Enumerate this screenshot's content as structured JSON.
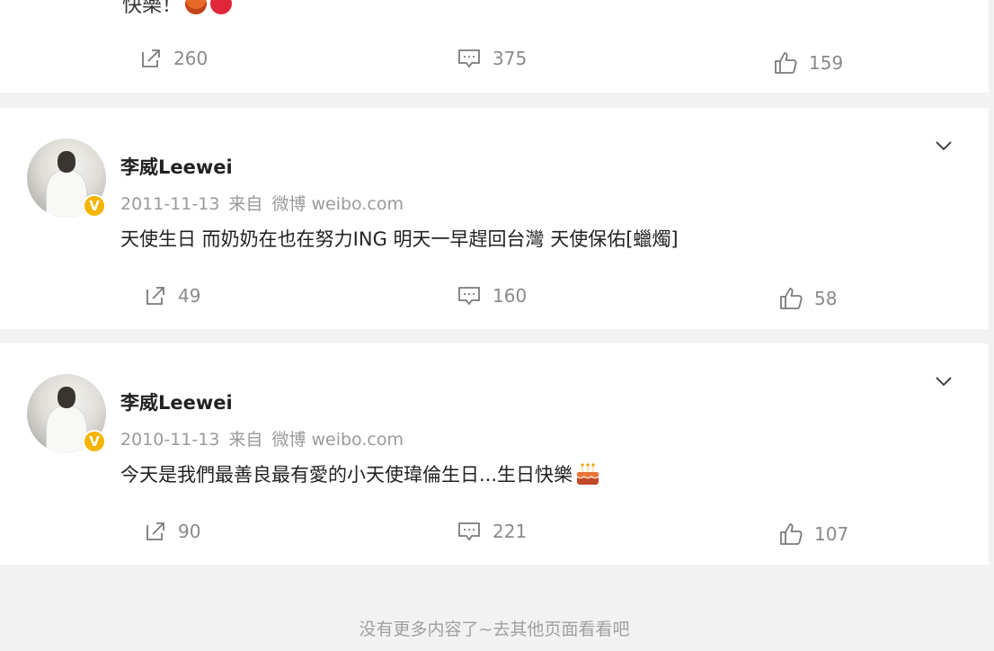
{
  "top_post": {
    "text": "快樂！",
    "emojis": [
      "cake-emoji",
      "heart-emoji"
    ],
    "repost_count": "260",
    "comment_count": "375",
    "like_count": "159"
  },
  "posts": [
    {
      "username": "李威Leewei",
      "date": "2011-11-13",
      "source_prefix": "来自",
      "source_name": "微博 weibo.com",
      "text": "天使生日 而奶奶在也在努力ING 明天一早趕回台灣 天使保佑[蠟燭]",
      "repost_count": "49",
      "comment_count": "160",
      "like_count": "58"
    },
    {
      "username": "李威Leewei",
      "date": "2010-11-13",
      "source_prefix": "来自",
      "source_name": "微博 weibo.com",
      "text": "今天是我們最善良最有愛的小天使瑋倫生日...生日快樂",
      "trailing_emoji": "cake-emoji",
      "repost_count": "90",
      "comment_count": "221",
      "like_count": "107"
    }
  ],
  "footer": {
    "text": "没有更多内容了~去其他页面看看吧"
  },
  "colors": {
    "page_bg": "#f2f2f2",
    "card_bg": "#ffffff",
    "meta_gray": "#9a9a9a",
    "verified_badge": "#f4b400"
  }
}
